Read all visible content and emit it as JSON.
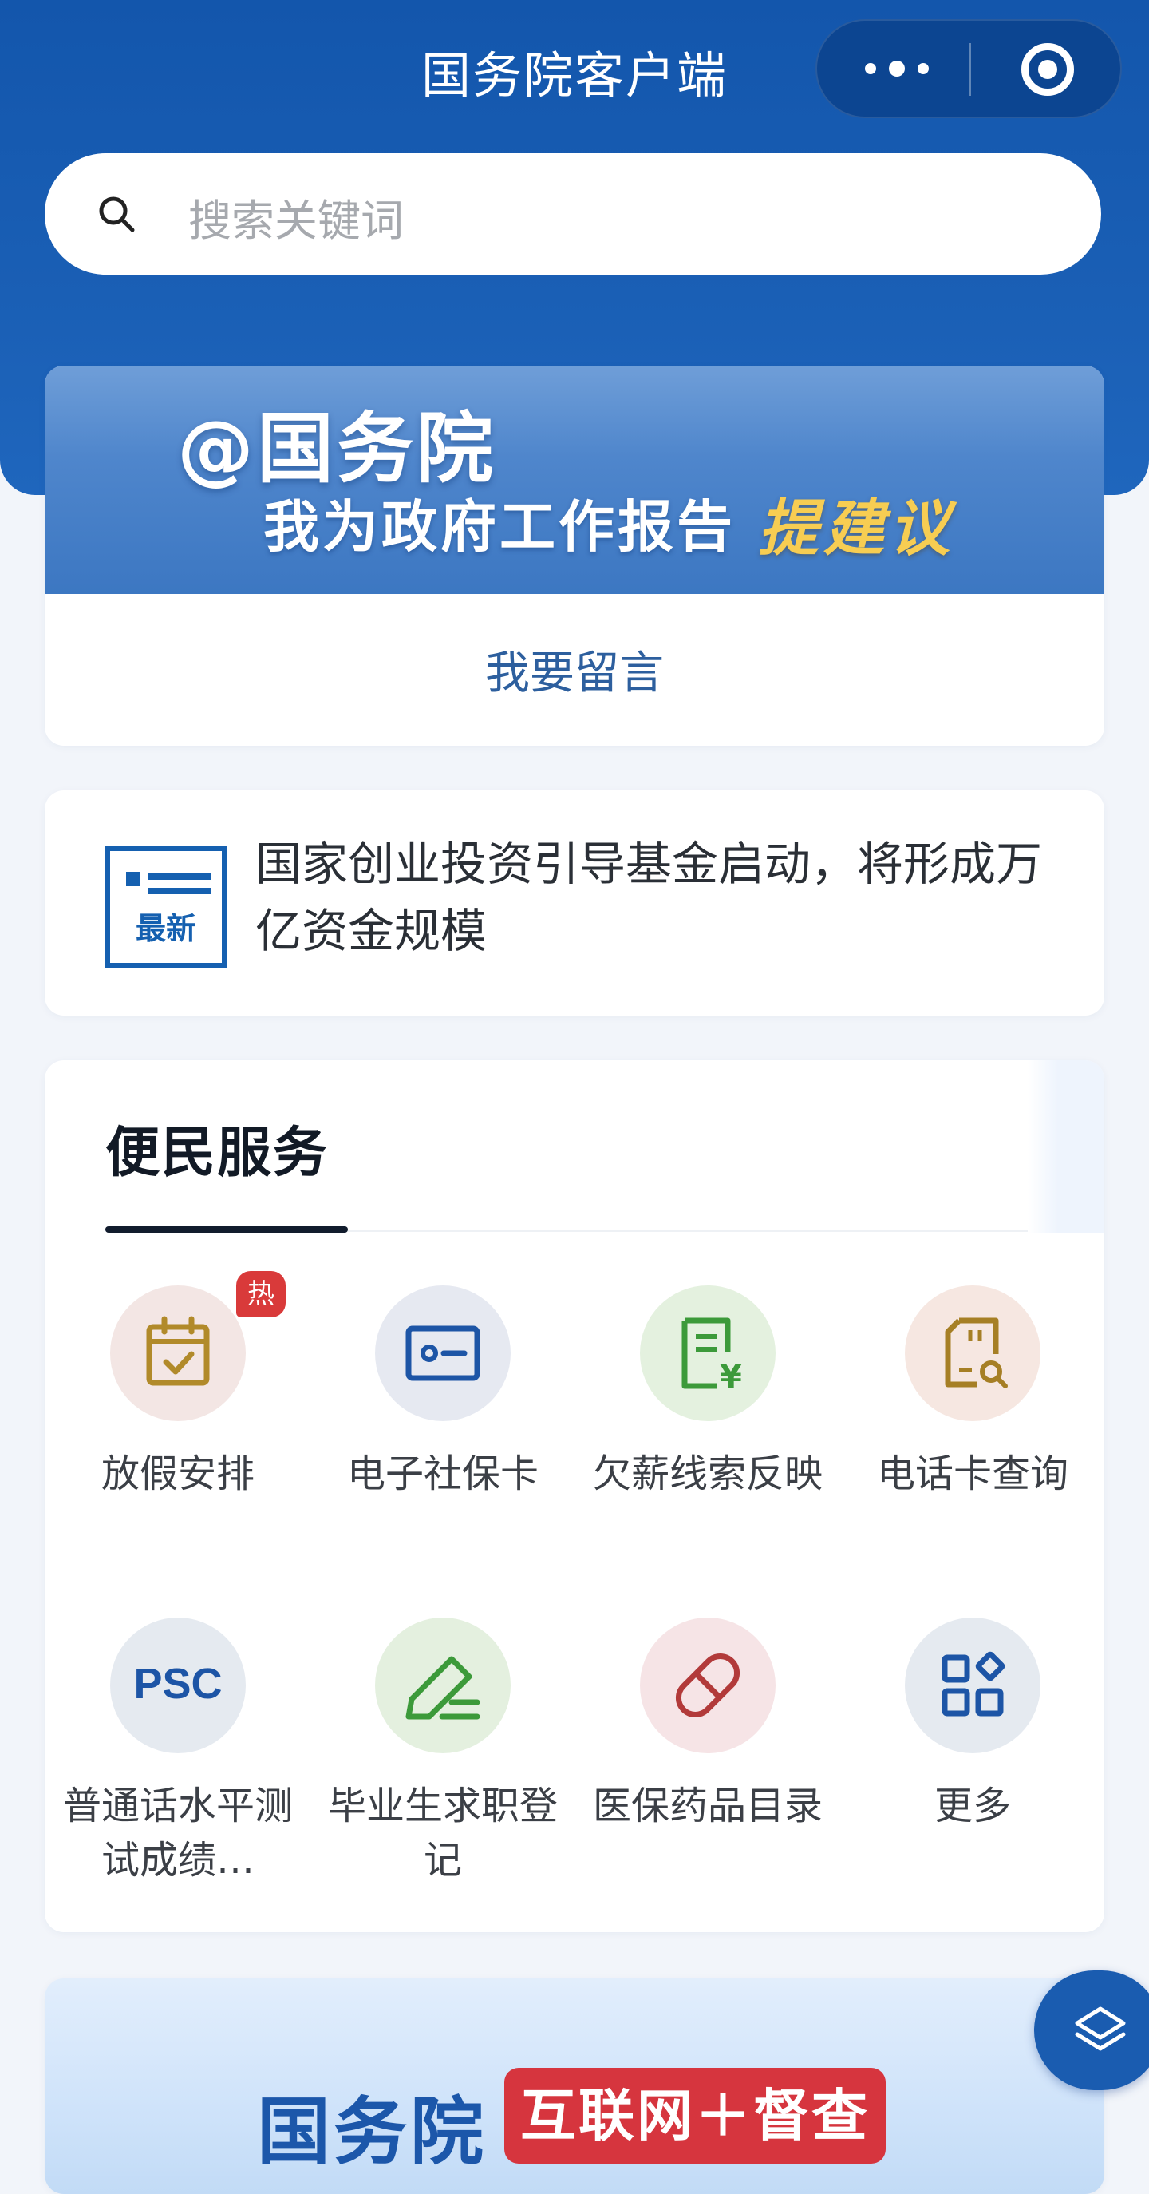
{
  "header": {
    "title": "国务院客户端",
    "more_icon": "more-dots-icon",
    "close_icon": "target-circle-icon"
  },
  "search": {
    "placeholder": "搜索关键词",
    "icon": "search-icon"
  },
  "banner": {
    "line1": "@国务院",
    "line2": "我为政府工作报告",
    "line2_highlight": "提建议",
    "action": "我要留言"
  },
  "news": {
    "badge": "最新",
    "headline": "国家创业投资引导基金启动，将形成万亿资金规模"
  },
  "services": {
    "title": "便民服务",
    "hot_badge": "热",
    "items": [
      {
        "label": "放假安排",
        "icon": "calendar-check-icon"
      },
      {
        "label": "电子社保卡",
        "icon": "id-card-icon"
      },
      {
        "label": "欠薪线索反映",
        "icon": "yuan-document-icon"
      },
      {
        "label": "电话卡查询",
        "icon": "sim-card-search-icon"
      },
      {
        "label": "普通话水平测试成绩…",
        "icon": "psc-icon",
        "icon_text": "PSC"
      },
      {
        "label": "毕业生求职登记",
        "icon": "pen-edit-icon"
      },
      {
        "label": "医保药品目录",
        "icon": "pill-icon"
      },
      {
        "label": "更多",
        "icon": "grid-more-icon"
      }
    ]
  },
  "bottom_banner": {
    "title": "国务院",
    "badge": "互联网＋督查"
  },
  "float_button": {
    "icon": "layers-icon"
  },
  "colors": {
    "brand_blue": "#1356ac",
    "hot_red": "#d93a3a",
    "highlight_gold": "#f7cd52"
  }
}
